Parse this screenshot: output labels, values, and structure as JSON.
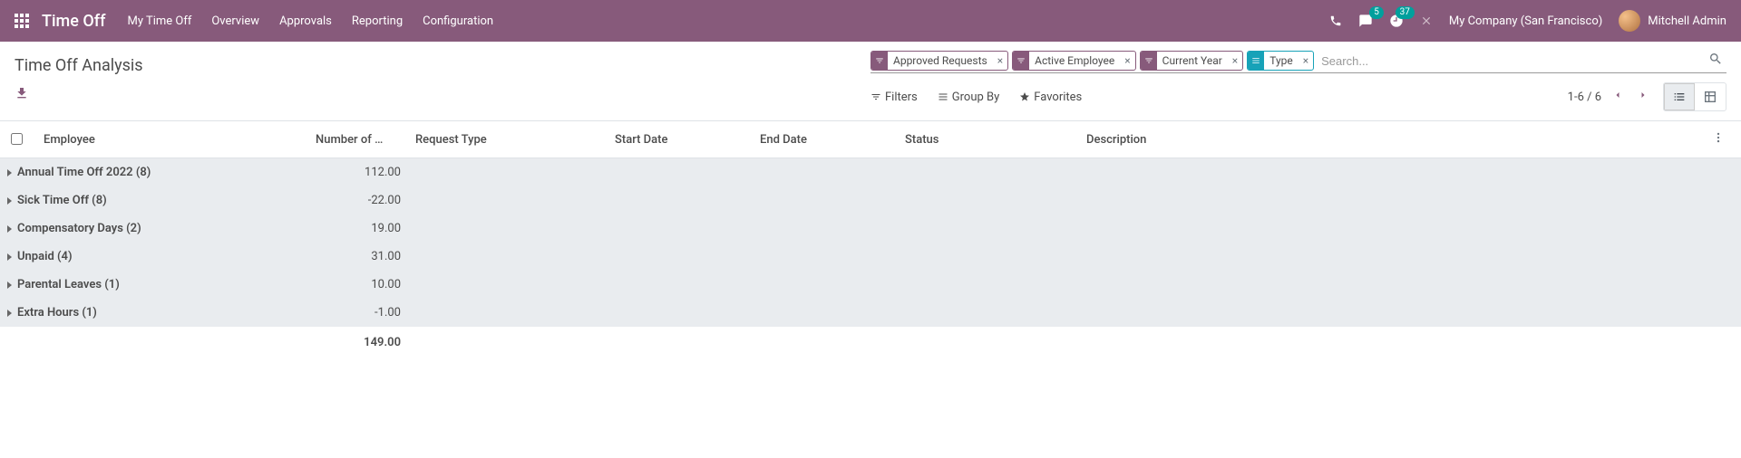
{
  "nav": {
    "brand": "Time Off",
    "items": [
      "My Time Off",
      "Overview",
      "Approvals",
      "Reporting",
      "Configuration"
    ],
    "messages_badge": "5",
    "activities_badge": "37",
    "company": "My Company (San Francisco)",
    "user": "Mitchell Admin"
  },
  "page": {
    "title": "Time Off Analysis"
  },
  "search": {
    "facets": [
      {
        "type": "filter",
        "label": "Approved Requests"
      },
      {
        "type": "filter",
        "label": "Active Employee"
      },
      {
        "type": "filter",
        "label": "Current Year"
      },
      {
        "type": "group",
        "label": "Type"
      }
    ],
    "placeholder": "Search..."
  },
  "toolbar": {
    "filters": "Filters",
    "groupby": "Group By",
    "favorites": "Favorites",
    "pager": "1-6 / 6"
  },
  "columns": {
    "employee": "Employee",
    "number_of_days": "Number of …",
    "request_type": "Request Type",
    "start_date": "Start Date",
    "end_date": "End Date",
    "status": "Status",
    "description": "Description"
  },
  "groups": [
    {
      "label": "Annual Time Off 2022 (8)",
      "value": "112.00"
    },
    {
      "label": "Sick Time Off (8)",
      "value": "-22.00"
    },
    {
      "label": "Compensatory Days (2)",
      "value": "19.00"
    },
    {
      "label": "Unpaid (4)",
      "value": "31.00"
    },
    {
      "label": "Parental Leaves (1)",
      "value": "10.00"
    },
    {
      "label": "Extra Hours (1)",
      "value": "-1.00"
    }
  ],
  "totals": {
    "number_of_days": "149.00"
  }
}
